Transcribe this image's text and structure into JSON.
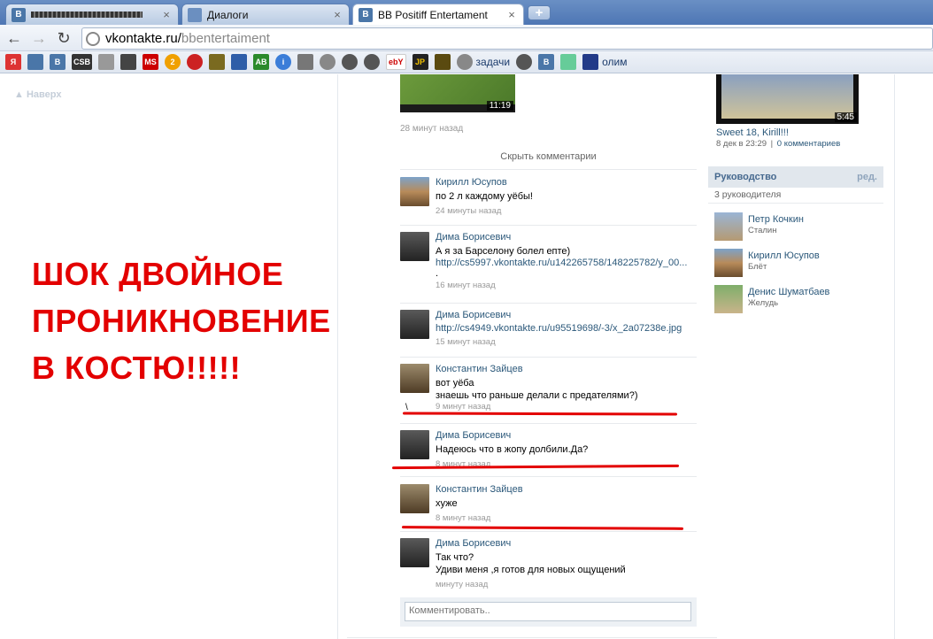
{
  "tabs": [
    {
      "title": "",
      "favicon": "B",
      "close": "×"
    },
    {
      "title": "Диалоги",
      "favicon": "",
      "close": "×"
    },
    {
      "title": "BB Positiff Entertament",
      "favicon": "B",
      "close": "×"
    }
  ],
  "newtab_label": "+",
  "address": {
    "host": "vkontakte.ru/",
    "path": "bbentertaiment"
  },
  "bookmarks": {
    "items": [
      "Я",
      "",
      "B",
      "CSB",
      "",
      "",
      "MS",
      "2",
      "",
      "",
      "",
      "AB",
      "i",
      "",
      "",
      "",
      "",
      "ebY",
      "JP",
      "",
      "",
      "",
      "B",
      ""
    ],
    "zadachi": "задачи",
    "olim": "олим"
  },
  "page": {
    "naverh": "▲ Наверх",
    "shock_lines": [
      "ШОК ДВОЙНОЕ",
      "ПРОНИКНОВЕНИЕ",
      "В КОСТЮ!!!!!"
    ],
    "post_video_time": "11:19",
    "post_time": "28 минут назад",
    "hide_comments": "Скрыть комментарии",
    "comments": [
      {
        "name": "Кирилл Юсупов",
        "text": "по 2 л каждому уёбы!",
        "time": "24 минуты назад"
      },
      {
        "name": "Дима Борисевич",
        "text": "А я за Барселону болел епте)",
        "link": "http://cs5997.vkontakte.ru/u142265758/148225782/y_00...",
        "extra": ".",
        "time": "16 минут назад"
      },
      {
        "name": "Дима Борисевич",
        "link": "http://cs4949.vkontakte.ru/u95519698/-3/x_2a07238e.jpg",
        "time": "15 минут назад"
      },
      {
        "name": "Константин Зайцев",
        "text": "вот уёба\nзнаешь что раньше делали с предателями?)",
        "extra": "\\",
        "time": "9 минут назад"
      },
      {
        "name": "Дима Борисевич",
        "text": "Надеюсь что в жопу долбили.Да?",
        "time": "8 минут назад"
      },
      {
        "name": "Константин Зайцев",
        "text": "хуже",
        "time": "8 минут назад"
      },
      {
        "name": "Дима Борисевич",
        "text": "Так что?\nУдиви меня ,я готов для новых ощущений",
        "time": "минуту назад"
      }
    ],
    "comment_placeholder": "Комментировать.."
  },
  "sidebar": {
    "video_time": "5:45",
    "video_title": "Sweet 18, Kirill!!!",
    "video_date": "8 дек в 23:29",
    "video_sep": "|",
    "video_comments": "0 комментариев",
    "leaders_title": "Руководство",
    "leaders_edit": "ред.",
    "leaders_count": "3 руководителя",
    "leaders": [
      {
        "name": "Петр Кочкин",
        "role": "Сталин"
      },
      {
        "name": "Кирилл Юсупов",
        "role": "Блёт"
      },
      {
        "name": "Денис Шуматбаев",
        "role": "Желудь"
      }
    ]
  },
  "colors": {
    "red_annotation": "#e30000",
    "vk_link": "#2b587a",
    "vk_header": "#45688e"
  }
}
